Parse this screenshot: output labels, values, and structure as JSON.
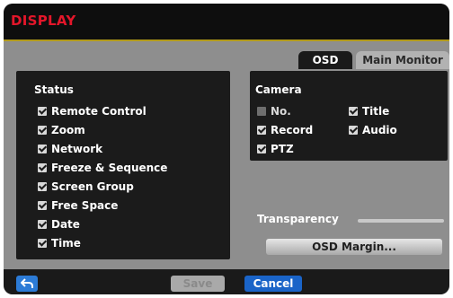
{
  "window": {
    "title": "DISPLAY"
  },
  "tabs": [
    {
      "label": "OSD",
      "selected": true
    },
    {
      "label": "Main Monitor",
      "selected": false
    }
  ],
  "status": {
    "heading": "Status",
    "items": [
      {
        "label": "Remote Control",
        "checked": true
      },
      {
        "label": "Zoom",
        "checked": true
      },
      {
        "label": "Network",
        "checked": true
      },
      {
        "label": "Freeze & Sequence",
        "checked": true
      },
      {
        "label": "Screen Group",
        "checked": true
      },
      {
        "label": "Free Space",
        "checked": true
      },
      {
        "label": "Date",
        "checked": true
      },
      {
        "label": "Time",
        "checked": true
      }
    ]
  },
  "camera": {
    "heading": "Camera",
    "items": [
      {
        "label": "No.",
        "checked": false
      },
      {
        "label": "Title",
        "checked": true
      },
      {
        "label": "Record",
        "checked": true
      },
      {
        "label": "Audio",
        "checked": true
      },
      {
        "label": "PTZ",
        "checked": true
      }
    ]
  },
  "transparency": {
    "label": "Transparency"
  },
  "buttons": {
    "osd_margin": "OSD Margin...",
    "save": "Save",
    "cancel": "Cancel"
  },
  "colors": {
    "title_red": "#e4162a",
    "accent_blue": "#1a64c8",
    "panel_black": "#1b1b1b",
    "dialog_gray": "#8e8e8e"
  },
  "icons": {
    "back": "back-arrow-icon"
  }
}
